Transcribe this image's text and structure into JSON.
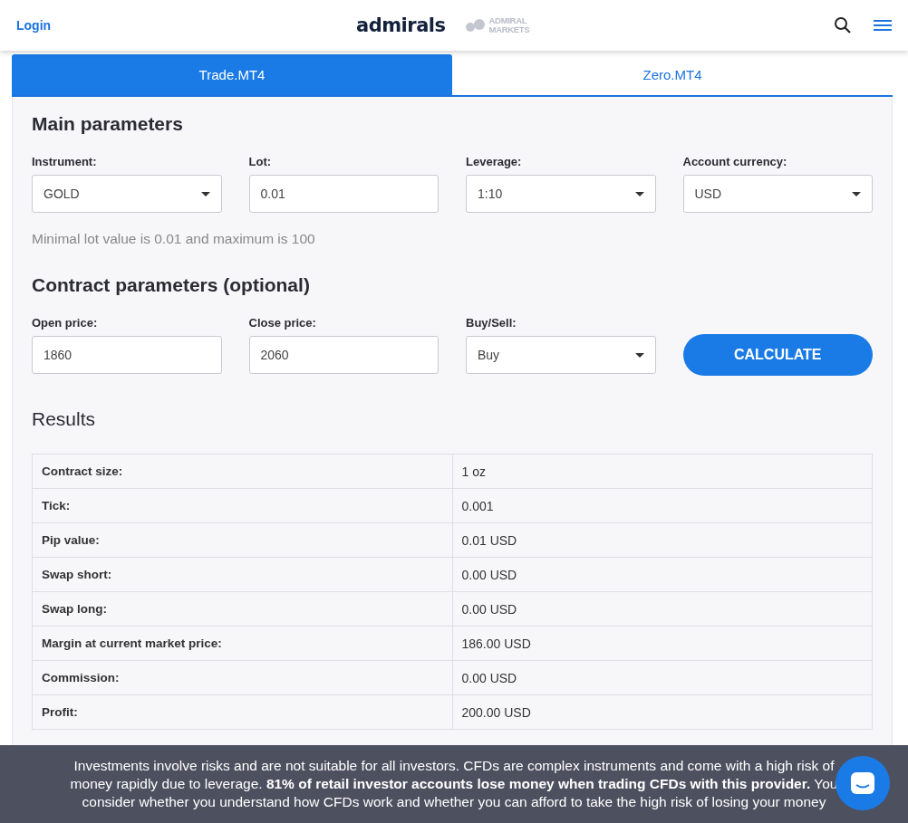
{
  "header": {
    "login": "Login",
    "logo": "admirals",
    "sub_logo_lines": [
      "ADMIRAL",
      "MARKETS"
    ]
  },
  "tabs": [
    {
      "label": "Trade.MT4",
      "selected": true
    },
    {
      "label": "Zero.MT4",
      "selected": false
    }
  ],
  "main_parameters": {
    "title": "Main parameters",
    "fields": [
      {
        "label": "Instrument:",
        "kind": "select",
        "value": "GOLD"
      },
      {
        "label": "Lot:",
        "kind": "input",
        "value": "0.01"
      },
      {
        "label": "Leverage:",
        "kind": "select",
        "value": "1:10"
      },
      {
        "label": "Account currency:",
        "kind": "select",
        "value": "USD"
      }
    ],
    "hint": "Minimal lot value is 0.01 and maximum is 100"
  },
  "contract_parameters": {
    "title": "Contract parameters (optional)",
    "fields": [
      {
        "label": "Open price:",
        "kind": "input",
        "value": "1860"
      },
      {
        "label": "Close price:",
        "kind": "input",
        "value": "2060"
      },
      {
        "label": "Buy/Sell:",
        "kind": "select",
        "value": "Buy"
      }
    ],
    "button": "CALCULATE"
  },
  "results": {
    "title": "Results",
    "rows": [
      {
        "name": "Contract size:",
        "value": "1 oz"
      },
      {
        "name": "Tick:",
        "value": "0.001"
      },
      {
        "name": "Pip value:",
        "value": "0.01 USD"
      },
      {
        "name": "Swap short:",
        "value": "0.00 USD"
      },
      {
        "name": "Swap long:",
        "value": "0.00 USD"
      },
      {
        "name": "Margin at current market price:",
        "value": "186.00 USD"
      },
      {
        "name": "Commission:",
        "value": "0.00 USD"
      },
      {
        "name": "Profit:",
        "value": "200.00 USD"
      }
    ]
  },
  "risk_banner": {
    "lines": [
      "Investments involve risks and are not suitable for all investors. CFDs are complex instruments and come with a high risk of",
      "money rapidly due to leverage. **81% of retail investor accounts lose money when trading CFDs with this provider.** You",
      "consider whether you understand how CFDs work and whether you can afford to take the high risk of losing your money"
    ]
  }
}
